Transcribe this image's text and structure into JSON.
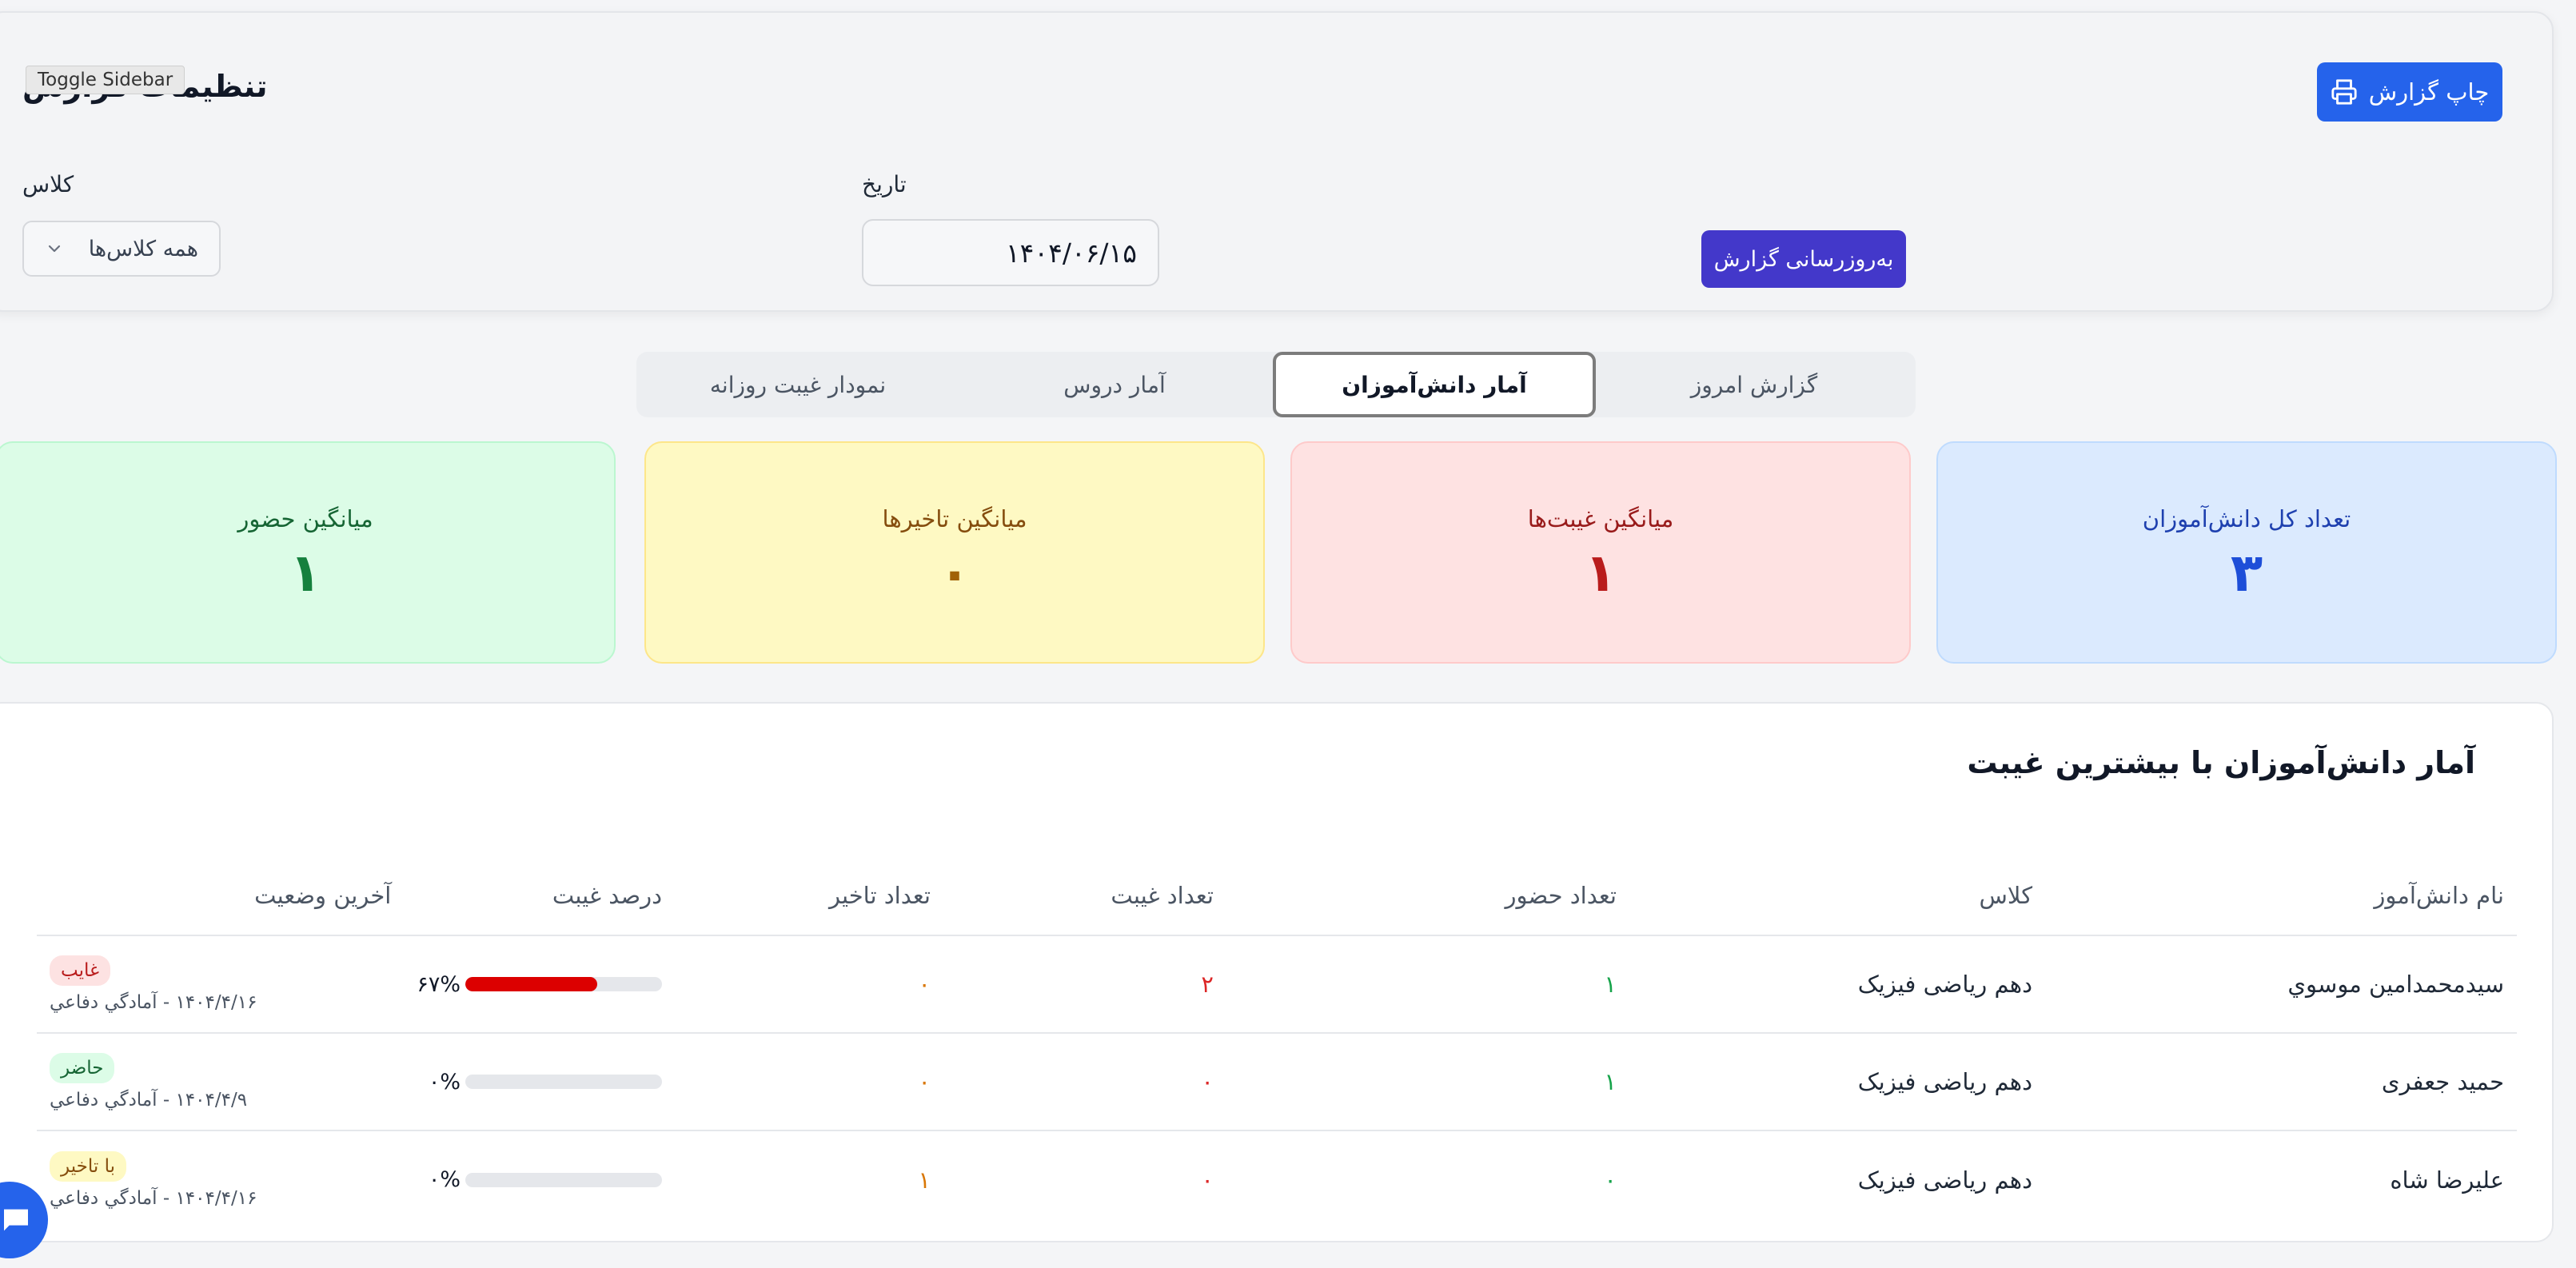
{
  "settings": {
    "title": "تنظیمات گزارش",
    "toggle_tooltip": "Toggle Sidebar",
    "print_label": "چاپ گزارش",
    "class_label": "کلاس",
    "class_value": "همه کلاس‌ها",
    "date_label": "تاریخ",
    "date_value": "۱۴۰۴/۰۶/۱۵",
    "refresh_label": "به‌روزرسانی گزارش"
  },
  "tabs": [
    {
      "label": "گزارش امروز",
      "active": false
    },
    {
      "label": "آمار دانش‌آموزان",
      "active": true
    },
    {
      "label": "آمار دروس",
      "active": false
    },
    {
      "label": "نمودار غیبت روزانه",
      "active": false
    }
  ],
  "stats": [
    {
      "label": "تعداد کل دانش‌آموزان",
      "value": "۳",
      "bg": "#dbeafe",
      "border": "#bfdbfe",
      "label_color": "#1e40af",
      "value_color": "#1d4ed8"
    },
    {
      "label": "میانگین غیبت‌ها",
      "value": "۱",
      "bg": "#fee2e2",
      "border": "#fecaca",
      "label_color": "#991b1b",
      "value_color": "#b91c1c"
    },
    {
      "label": "میانگین تاخیرها",
      "value": "۰",
      "bg": "#fef9c3",
      "border": "#fde68a",
      "label_color": "#854d0e",
      "value_color": "#a16207"
    },
    {
      "label": "میانگین حضور",
      "value": "۱",
      "bg": "#dcfce7",
      "border": "#bbf7d0",
      "label_color": "#166534",
      "value_color": "#15803d"
    }
  ],
  "table": {
    "title": "آمار دانش‌آموزان با بیشترین غیبت",
    "headers": [
      "نام دانش‌آموز",
      "کلاس",
      "تعداد حضور",
      "تعداد غیبت",
      "تعداد تاخیر",
      "درصد غیبت",
      "آخرین وضعیت"
    ],
    "rows": [
      {
        "name": "سیدمحمدامین موسوي",
        "class": "دهم ریاضی فیزیک",
        "present": "۱",
        "absent": "۲",
        "late": "۰",
        "percent_text": "۶۷%",
        "percent": 0.67,
        "status": "غایب",
        "status_type": "absent",
        "status_date": "۱۴۰۴/۴/۱۶ - آمادگي دفاعي"
      },
      {
        "name": "حمید جعفری",
        "class": "دهم ریاضی فیزیک",
        "present": "۱",
        "absent": "۰",
        "late": "۰",
        "percent_text": "۰%",
        "percent": 0,
        "status": "حاضر",
        "status_type": "present",
        "status_date": "۱۴۰۴/۴/۹ - آمادگي دفاعي"
      },
      {
        "name": "علیرضا شاه",
        "class": "دهم ریاضی فیزیک",
        "present": "۰",
        "absent": "۰",
        "late": "۱",
        "percent_text": "۰%",
        "percent": 0,
        "status": "با تاخیر",
        "status_type": "late",
        "status_date": "۱۴۰۴/۴/۱۶ - آمادگي دفاعي"
      }
    ]
  },
  "icons": {
    "print": "printer-icon",
    "select": "chevron-down-icon",
    "chat": "chat-icon"
  },
  "colors": {
    "primary": "#2563eb",
    "refresh": "#4338ca",
    "progress": "#dc0000"
  }
}
